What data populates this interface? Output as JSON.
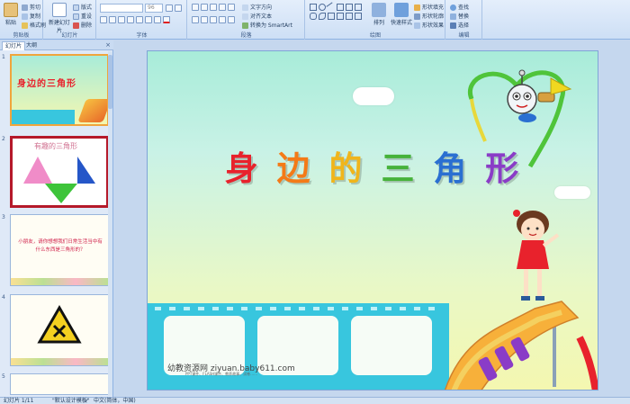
{
  "ribbon": {
    "groups": {
      "clipboard": "剪贴板",
      "slides": "幻灯片",
      "font": "字体",
      "paragraph": "段落",
      "drawing": "绘图",
      "editing": "编辑"
    },
    "clipboard": {
      "paste": "粘贴",
      "cut": "剪切",
      "copy": "复制",
      "format_painter": "格式刷"
    },
    "slides": {
      "new_slide": "新建幻灯片",
      "layout": "版式",
      "reset": "重设",
      "delete": "删除"
    },
    "font": {
      "font_name": "",
      "font_size": "96"
    },
    "paragraph": {
      "text_direction": "文字方向",
      "align_text": "对齐文本",
      "smartart": "转换为 SmartArt"
    },
    "drawing": {
      "arrange": "排列",
      "quick_styles": "快速样式",
      "shape_fill": "形状填充",
      "shape_outline": "形状轮廓",
      "shape_effects": "形状效果"
    },
    "editing": {
      "find": "查找",
      "replace": "替换",
      "select": "选择"
    }
  },
  "panel": {
    "tabs": [
      "幻灯片",
      "大纲"
    ],
    "close": "×",
    "thumbnails": [
      {
        "num": "1",
        "title": "身边的三角形"
      },
      {
        "num": "2",
        "title": "有趣的三角形"
      },
      {
        "num": "3",
        "text": "小朋友，请你想想我们日常生活当中有什么东西是三角形的？"
      },
      {
        "num": "4"
      },
      {
        "num": "5"
      }
    ]
  },
  "slide": {
    "title_chars": [
      "身",
      "边",
      "的",
      "三",
      "角",
      "形"
    ],
    "title_colors": [
      "#e8222c",
      "#f47a17",
      "#f0b51b",
      "#46b23a",
      "#2a6fd1",
      "#8a3cc7"
    ],
    "watermark": "幼教资源网 ziyuan.baby611.com",
    "watermark_sub": "PPT课件、FLASH课件、教养故事、试卷……"
  },
  "status": {
    "slide_count": "幻灯片 1/11",
    "theme": "\"默认设计模板\"",
    "language": "中文(简体，中国)"
  }
}
